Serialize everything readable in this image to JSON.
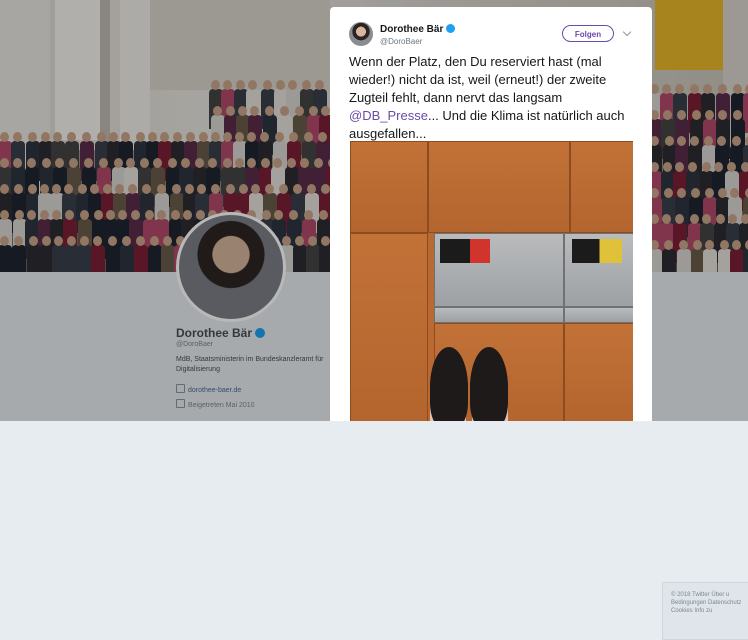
{
  "profile": {
    "name": "Dorothee Bär",
    "handle": "@DoroBaer",
    "bio": "MdB, Staatsministerin im Bundeskanzleramt für Digitalisierung",
    "link": "dorothee-baer.de",
    "joined": "Beigetreten Mai 2010"
  },
  "footer": {
    "line1": "© 2018 Twitter   Über u",
    "line2": "Bedingungen   Datenschutz",
    "line3": "Cookies   Info zu"
  },
  "tweet": {
    "author_name": "Dorothee Bär",
    "author_handle": "@DoroBaer",
    "follow_label": "Folgen",
    "text_before": "Wenn der Platz, den Du reserviert hast (mal wieder!) nicht da ist, weil (erneut!) der zweite Zugteil fehlt, dann nervt das langsam ",
    "mention": "@DB_Presse",
    "text_after": "... Und die Klima ist natürlich auch ausgefallen..."
  },
  "colors": {
    "accent": "#6b4aa8",
    "verified": "#1da1f2"
  },
  "icons": [
    "verified-badge-icon",
    "chevron-down-icon",
    "link-icon",
    "calendar-icon"
  ]
}
